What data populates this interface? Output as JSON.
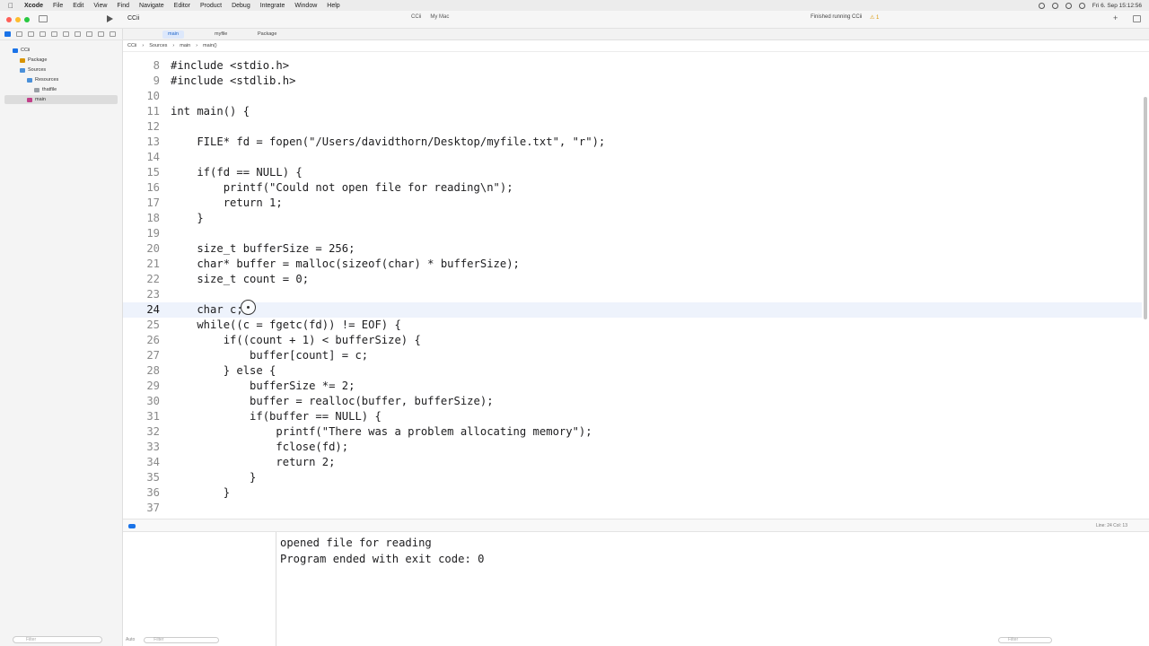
{
  "menubar": {
    "items": [
      "Xcode",
      "File",
      "Edit",
      "View",
      "Find",
      "Navigate",
      "Editor",
      "Product",
      "Debug",
      "Integrate",
      "Window",
      "Help"
    ],
    "clock": "Fri 6. Sep 15:12:56"
  },
  "toolbar": {
    "project": "CCii",
    "scheme": "CCii",
    "destination": "My Mac",
    "status": "Finished running CCii",
    "warnings": "1"
  },
  "navigator": {
    "rows": [
      {
        "label": "CCii",
        "icon_color": "#1a73e8"
      },
      {
        "label": "Package",
        "icon_color": "#d89400"
      },
      {
        "label": "Sources",
        "icon_color": "#4a90d9"
      },
      {
        "label": "Resources",
        "icon_color": "#4a90d9"
      },
      {
        "label": "thatfile",
        "icon_color": "#9aa0a6"
      },
      {
        "label": "main",
        "icon_color": "#c1408a"
      }
    ],
    "filter_placeholder": "Filter"
  },
  "tabs": [
    "main",
    "myfile",
    "Package"
  ],
  "jumpbar": [
    "CCii",
    "Sources",
    "main",
    "main()"
  ],
  "editor": {
    "lines": [
      {
        "n": "8",
        "code": "#include <stdio.h>"
      },
      {
        "n": "9",
        "code": "#include <stdlib.h>"
      },
      {
        "n": "10",
        "code": ""
      },
      {
        "n": "11",
        "code": "int main() {"
      },
      {
        "n": "12",
        "code": ""
      },
      {
        "n": "13",
        "code": "    FILE* fd = fopen(\"/Users/davidthorn/Desktop/myfile.txt\", \"r\");"
      },
      {
        "n": "14",
        "code": ""
      },
      {
        "n": "15",
        "code": "    if(fd == NULL) {"
      },
      {
        "n": "16",
        "code": "        printf(\"Could not open file for reading\\n\");"
      },
      {
        "n": "17",
        "code": "        return 1;"
      },
      {
        "n": "18",
        "code": "    }"
      },
      {
        "n": "19",
        "code": ""
      },
      {
        "n": "20",
        "code": "    size_t bufferSize = 256;"
      },
      {
        "n": "21",
        "code": "    char* buffer = malloc(sizeof(char) * bufferSize);"
      },
      {
        "n": "22",
        "code": "    size_t count = 0;"
      },
      {
        "n": "23",
        "code": ""
      },
      {
        "n": "24",
        "code": "    char c;"
      },
      {
        "n": "25",
        "code": "    while((c = fgetc(fd)) != EOF) {"
      },
      {
        "n": "26",
        "code": "        if((count + 1) < bufferSize) {"
      },
      {
        "n": "27",
        "code": "            buffer[count] = c;"
      },
      {
        "n": "28",
        "code": "        } else {"
      },
      {
        "n": "29",
        "code": "            bufferSize *= 2;"
      },
      {
        "n": "30",
        "code": "            buffer = realloc(buffer, bufferSize);"
      },
      {
        "n": "31",
        "code": "            if(buffer == NULL) {"
      },
      {
        "n": "32",
        "code": "                printf(\"There was a problem allocating memory\");"
      },
      {
        "n": "33",
        "code": "                fclose(fd);"
      },
      {
        "n": "34",
        "code": "                return 2;"
      },
      {
        "n": "35",
        "code": "            }"
      },
      {
        "n": "36",
        "code": "        }"
      },
      {
        "n": "37",
        "code": ""
      }
    ],
    "current_line": "24",
    "position_label": "Line: 24  Col: 13"
  },
  "console": {
    "lines": [
      "opened file for reading",
      "Program ended with exit code: 0"
    ],
    "variables_scope": "Auto",
    "filter_placeholder": "Filter"
  }
}
